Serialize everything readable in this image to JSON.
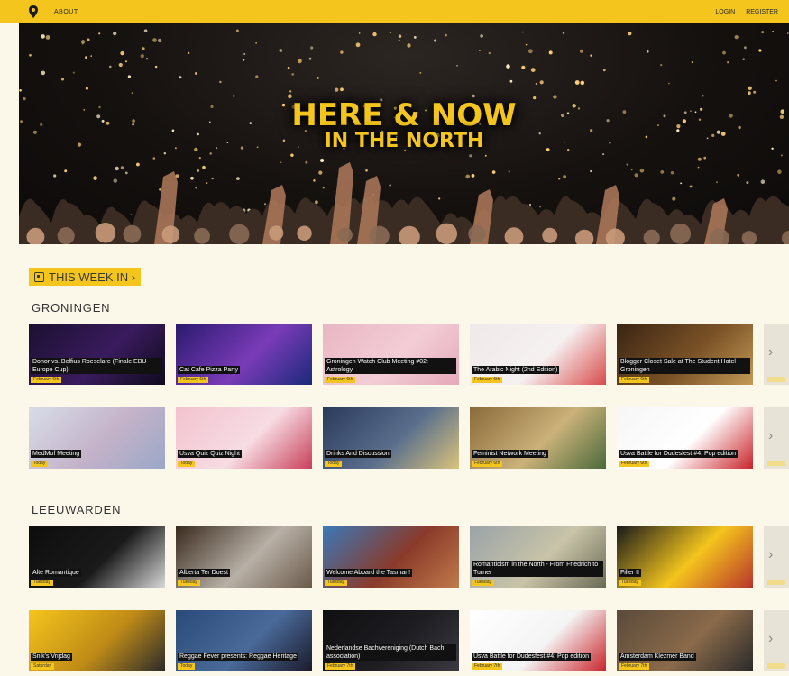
{
  "nav": {
    "logo_icon": "location-pin-icon",
    "about": "ABOUT",
    "login": "LOGIN",
    "register": "REGISTER"
  },
  "hero": {
    "title": "HERE & NOW",
    "subtitle": "IN THE NORTH"
  },
  "this_week": {
    "icon": "calendar-icon",
    "label": "THIS WEEK IN ›"
  },
  "cities": [
    {
      "name": "GRONINGEN",
      "rows": [
        [
          {
            "title": "Donor vs. Belfius Roeselare (Finale EBU Europe Cup)",
            "date": "February 6th"
          },
          {
            "title": "Cat Cafe Pizza Party",
            "date": "February 6th"
          },
          {
            "title": "Groningen Watch Club Meeting #02: Astrology",
            "date": "February 6th"
          },
          {
            "title": "The Arabic Night (2nd Edition)",
            "date": "February 6th"
          },
          {
            "title": "Blogger Closet Sale at The Student Hotel Groningen",
            "date": "February 6th"
          }
        ],
        [
          {
            "title": "MedMof Meeting",
            "date": "Today"
          },
          {
            "title": "Usva Quiz Quiz Night",
            "date": "Today"
          },
          {
            "title": "Drinks And Discussion",
            "date": "Today"
          },
          {
            "title": "Feminist Network Meeting",
            "date": "February 6th"
          },
          {
            "title": "Usva Battle for Dudesfest #4: Pop edition",
            "date": "February 6th"
          }
        ]
      ]
    },
    {
      "name": "LEEUWARDEN",
      "rows": [
        [
          {
            "title": "Alte Romantique",
            "date": "Tuesday"
          },
          {
            "title": "Alberta Ter Doest",
            "date": "Tuesday"
          },
          {
            "title": "Welcome Aboard the Tasman!",
            "date": "Tuesday"
          },
          {
            "title": "Romanticism in the North - From Friedrich to Turner",
            "date": "Tuesday"
          },
          {
            "title": "Filler II",
            "date": "Tuesday"
          }
        ],
        [
          {
            "title": "Snik's Vrijdag",
            "date": "Saturday"
          },
          {
            "title": "Reggae Fever presents: Reggae Heritage",
            "date": "Today"
          },
          {
            "title": "Nederlandse Bachvereniging (Dutch Bach association)",
            "date": "February 7th"
          },
          {
            "title": "Usva Battle for Dudesfest #4: Pop edition",
            "date": "February 7th"
          },
          {
            "title": "Amsterdam Klezmer Band",
            "date": "February 7th"
          }
        ]
      ]
    }
  ],
  "carousel_next_icon": "chevron-right-icon",
  "colors": {
    "brand_yellow": "#f4c51d",
    "page_bg": "#fbf8ea",
    "caption_bg": "#111111"
  }
}
